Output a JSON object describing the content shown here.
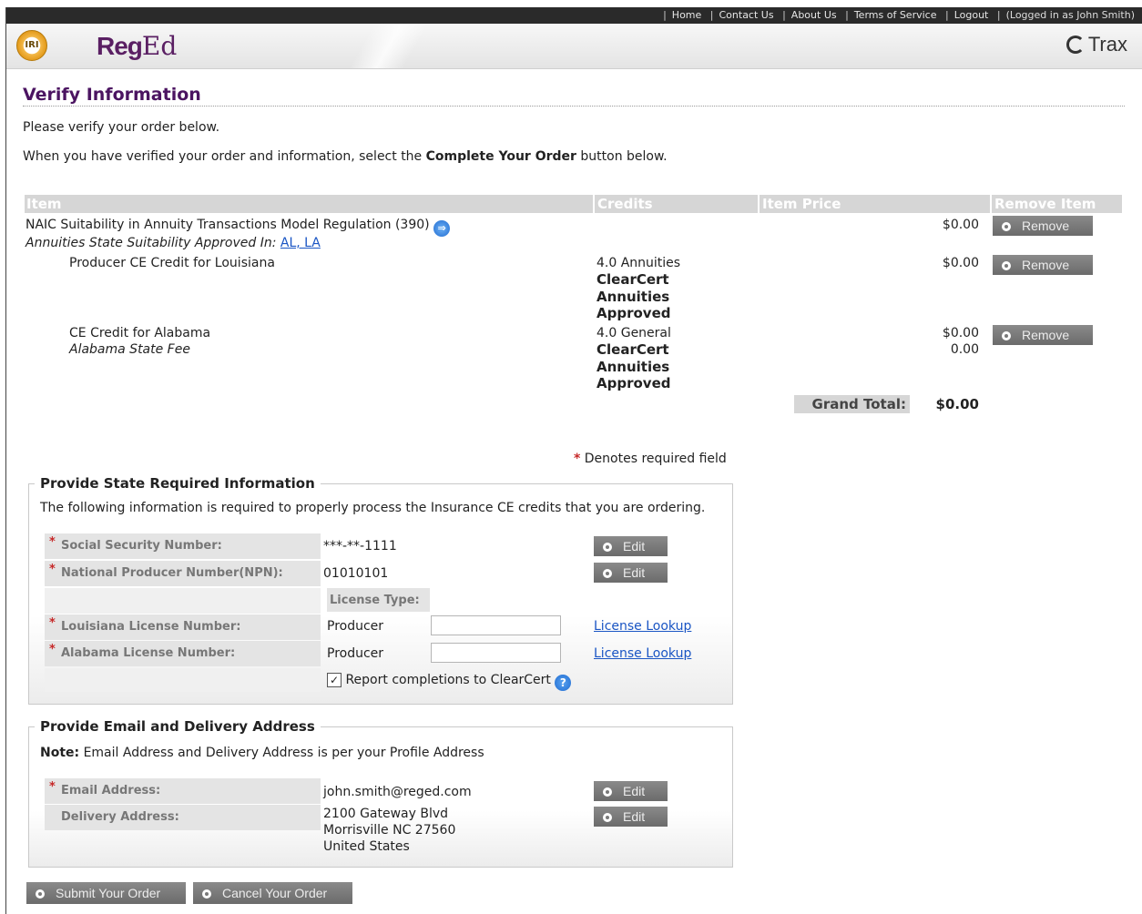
{
  "topnav": {
    "links": [
      "Home",
      "Contact Us",
      "About Us",
      "Terms of Service",
      "Logout"
    ],
    "user": "(Logged in as John  Smith)"
  },
  "header": {
    "iri_logo": "IRI",
    "brand_bold": "Reg",
    "brand_light": "Ed",
    "trax": "Trax"
  },
  "page": {
    "title": "Verify Information",
    "intro1": "Please verify your order below.",
    "intro2_pre": "When you have verified your order and information, select the ",
    "intro2_bold": "Complete Your Order",
    "intro2_post": " button below."
  },
  "order_table": {
    "headers": {
      "item": "Item",
      "credits": "Credits",
      "price": "Item Price",
      "remove": "Remove Item"
    },
    "rows": [
      {
        "name": "NAIC Suitability in Annuity Transactions Model Regulation (390)",
        "approved_label": "Annuities State Suitability Approved In: ",
        "approved_states": "AL, LA",
        "price": "$0.00",
        "remove": "Remove"
      },
      {
        "name": "Producer CE Credit for Louisiana",
        "credits": "4.0 Annuities",
        "clearcert": [
          "ClearCert",
          "Annuities",
          "Approved"
        ],
        "price": "$0.00",
        "remove": "Remove"
      },
      {
        "name": "CE Credit for Alabama",
        "sub": "Alabama State Fee",
        "credits": "4.0 General",
        "clearcert": [
          "ClearCert",
          "Annuities",
          "Approved"
        ],
        "price": "$0.00",
        "price2": "0.00",
        "remove": "Remove"
      }
    ],
    "grand_total_label": "Grand Total:",
    "grand_total": "$0.00"
  },
  "required_note": {
    "star": "*",
    "text": " Denotes required field"
  },
  "state_info": {
    "legend": "Provide State Required Information",
    "desc": "The following information is required to properly process the Insurance CE credits that you are ordering.",
    "ssn_label": "Social Security Number:",
    "ssn_value": "***-**-1111",
    "npn_label": "National Producer Number(NPN):",
    "npn_value": "01010101",
    "license_type_header": "License Type:",
    "la_label": "Louisiana License Number:",
    "la_type": "Producer",
    "al_label": "Alabama License Number:",
    "al_type": "Producer",
    "lookup": "License Lookup",
    "report_label": "Report completions to ClearCert",
    "report_checked": true,
    "edit": "Edit",
    "star": "*"
  },
  "email_info": {
    "legend": "Provide Email and Delivery Address",
    "note_bold": "Note:",
    "note_text": " Email Address and Delivery Address is per your Profile Address",
    "email_label": "Email Address:",
    "email_value": "john.smith@reged.com",
    "addr_label": "Delivery Address:",
    "addr_line1": "2100 Gateway Blvd",
    "addr_line2": "Morrisville NC 27560",
    "addr_line3": "United States",
    "edit": "Edit",
    "star": "*"
  },
  "actions": {
    "submit": "Submit Your Order",
    "cancel": "Cancel Your Order"
  }
}
